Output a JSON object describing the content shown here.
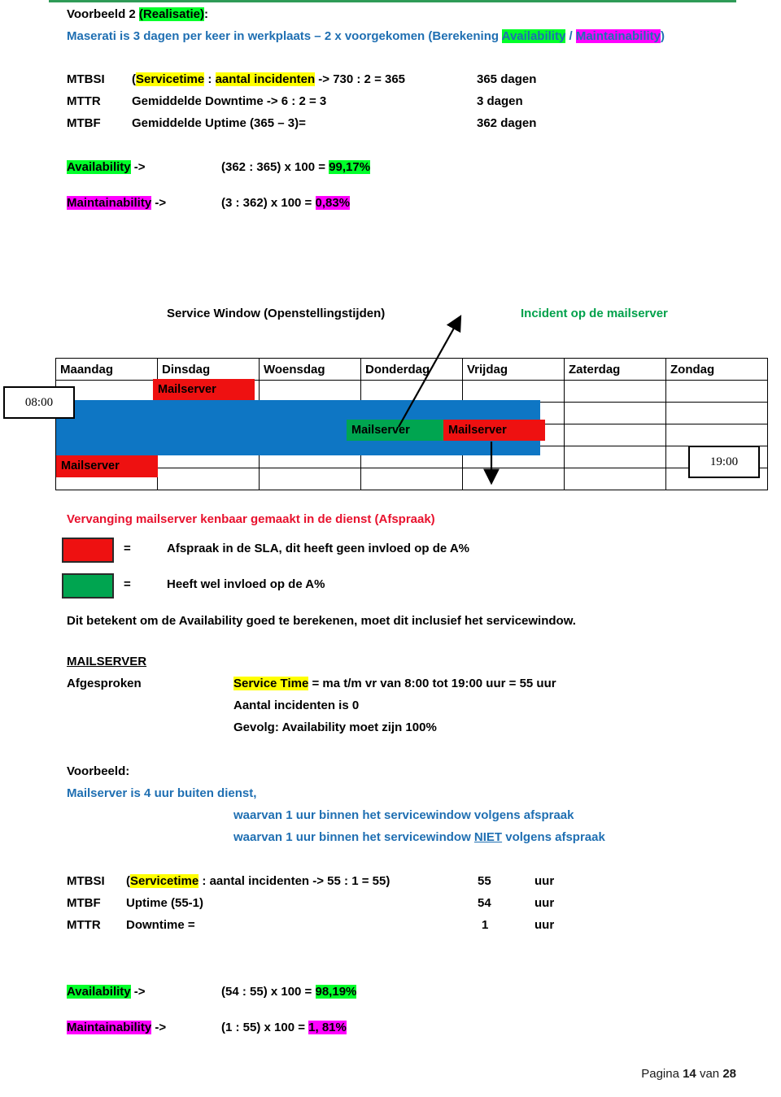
{
  "header": {
    "title_plain": "Voorbeeld 2 ",
    "title_hl": "(Realisatie)",
    "title_tail": ":",
    "subtitle_pre": "Maserati is 3 dagen per keer in werkplaats – 2 x voorgekomen (Berekening ",
    "subtitle_avail": "Availability",
    "subtitle_sep": " / ",
    "subtitle_maint": "Maintainability",
    "subtitle_tail": ")"
  },
  "metrics_top": {
    "rows": [
      {
        "key": "MTBSI",
        "formula_open": "(",
        "formula_hl": "Servicetime",
        "formula_mid": " : ",
        "formula_hl2": "aantal incidenten",
        "formula_rest": " -> 730 : 2 = 365",
        "value": "365 dagen"
      },
      {
        "key": "MTTR",
        "formula_plain": "Gemiddelde Downtime -> 6 : 2 = 3",
        "value": "3 dagen"
      },
      {
        "key": "MTBF",
        "formula_plain": "Gemiddelde Uptime (365 – 3)=",
        "value": "362 dagen"
      }
    ]
  },
  "calc_top": {
    "availability_label": "Availability",
    "availability_arrow": " ->",
    "availability_formula": "(362 : 365) x 100 = ",
    "availability_result": "99,17%",
    "maintainability_label": "Maintainability",
    "maintainability_arrow": " ->",
    "maintainability_formula": "(3 : 362) x 100 = ",
    "maintainability_result": "0,83%"
  },
  "chart_data": {
    "type": "table",
    "title": "Service Window (Openstellingstijden)",
    "annotation": "Incident op de mailserver",
    "categories": [
      "Maandag",
      "Dinsdag",
      "Woensdag",
      "Donderdag",
      "Vrijdag",
      "Zaterdag",
      "Zondag"
    ],
    "start_time": "08:00",
    "end_time": "19:00",
    "service_window_days": [
      "Maandag",
      "Dinsdag",
      "Woensdag",
      "Donderdag",
      "Vrijdag"
    ],
    "events": [
      {
        "day": "Dinsdag",
        "label": "Mailserver",
        "color": "#EE1111",
        "type": "afspraak",
        "position": "before-window"
      },
      {
        "day": "Donderdag",
        "label": "Mailserver",
        "color": "#00A550",
        "type": "incident",
        "position": "in-window"
      },
      {
        "day": "Vrijdag",
        "label": "Mailserver",
        "color": "#EE1111",
        "type": "afspraak",
        "position": "in-window"
      },
      {
        "day": "Maandag",
        "label": "Mailserver",
        "color": "#EE1111",
        "type": "afspraak",
        "position": "after-window"
      }
    ],
    "window_color": "#0E76C4",
    "grid": true
  },
  "legend": {
    "heading": "Vervanging mailserver kenbaar gemaakt in de dienst (Afspraak)",
    "items": [
      {
        "color": "#EE1111",
        "eq": "=",
        "text": "Afspraak in de SLA, dit heeft geen invloed op de A%"
      },
      {
        "color": "#00A550",
        "eq": "=",
        "text": "Heeft wel invloed op de A%"
      }
    ],
    "note": "Dit betekent om de Availability goed te berekenen, moet dit inclusief het servicewindow."
  },
  "mailserver": {
    "title": "MAILSERVER",
    "agreed_label": "Afgesproken",
    "service_time_hl": "Service Time",
    "service_time_rest": " = ma t/m vr van 8:00 tot 19:00 uur = 55 uur",
    "incidents": "Aantal incidenten is 0",
    "consequence": "Gevolg: Availability moet zijn 100%"
  },
  "example": {
    "label": "Voorbeeld:",
    "line1": "Mailserver is 4 uur buiten dienst,",
    "line2": "waarvan 1 uur binnen het servicewindow volgens afspraak",
    "line3_pre": "waarvan 1 uur binnen het servicewindow ",
    "line3_u": "NIET",
    "line3_post": " volgens afspraak"
  },
  "metrics_bottom": {
    "rows": [
      {
        "key": "MTBSI",
        "formula_open": "(",
        "formula_hl": "Servicetime",
        "formula_rest": " : aantal incidenten -> 55 : 1 = 55)",
        "value": "55",
        "unit": "uur"
      },
      {
        "key": "MTBF",
        "formula_plain": "Uptime (55-1)",
        "value": "54",
        "unit": "uur"
      },
      {
        "key": "MTTR",
        "formula_plain": "Downtime =",
        "value": "1",
        "unit": "uur"
      }
    ]
  },
  "calc_bottom": {
    "availability_label": "Availability",
    "availability_arrow": " ->",
    "availability_formula": "(54 : 55) x 100 = ",
    "availability_result": "98,19%",
    "maintainability_label": "Maintainability",
    "maintainability_arrow": " ->",
    "maintainability_formula": "(1 : 55) x 100 = ",
    "maintainability_result": "1, 81%"
  },
  "footer": {
    "pre": "Pagina ",
    "page": "14",
    "mid": " van ",
    "total": "28"
  }
}
